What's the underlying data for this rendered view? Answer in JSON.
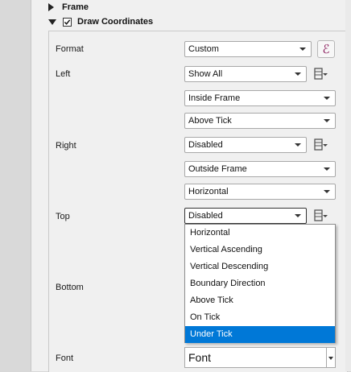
{
  "groups": {
    "frame_label": "Frame",
    "draw_coordinates_label": "Draw Coordinates",
    "draw_coordinates_checked": true
  },
  "labels": {
    "format": "Format",
    "left": "Left",
    "right": "Right",
    "top": "Top",
    "bottom": "Bottom",
    "font": "Font"
  },
  "combos": {
    "format": "Custom",
    "left_mode": "Show All",
    "left_position": "Inside Frame",
    "left_direction": "Above Tick",
    "right_mode": "Disabled",
    "right_position": "Outside Frame",
    "right_direction": "Horizontal",
    "top_mode": "Disabled",
    "font": "Font"
  },
  "icons": {
    "expression": "expression-epsilon-icon",
    "data_defined": "data-defined-override-icon"
  },
  "dropdown": {
    "items": [
      "Horizontal",
      "Vertical Ascending",
      "Vertical Descending",
      "Boundary Direction",
      "Above Tick",
      "On Tick",
      "Under Tick"
    ],
    "selected": "Under Tick"
  },
  "colors": {
    "selection": "#0078d7",
    "expression_icon": "#8a1c5c"
  }
}
